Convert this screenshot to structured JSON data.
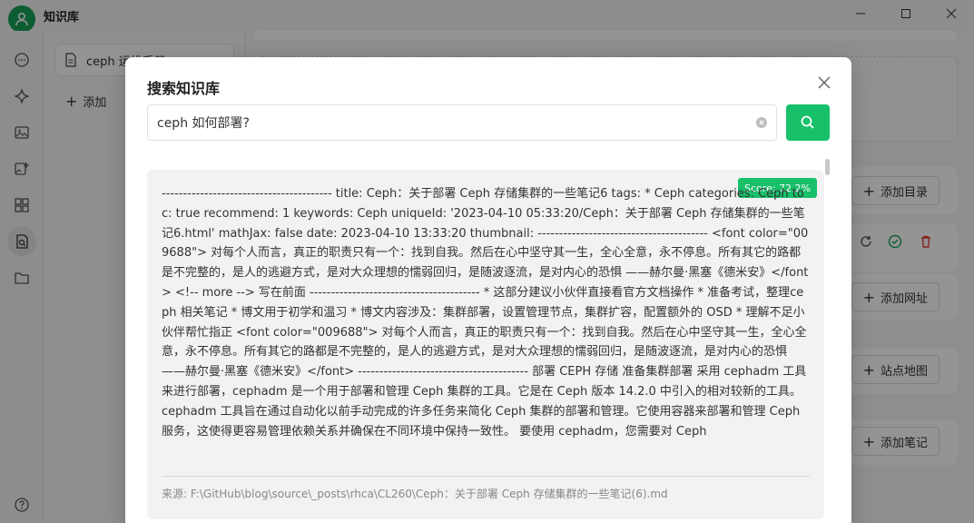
{
  "app": {
    "title": "知识库",
    "window_controls": {
      "minimize": "—",
      "maximize": "☐",
      "close": "✕"
    }
  },
  "rail": {
    "icons": [
      "chat-icon",
      "sparkle-icon",
      "image-icon",
      "image-edit-icon",
      "grid-icon",
      "knowledge-search-icon",
      "folder-icon",
      "help-icon"
    ],
    "active": "knowledge-search-icon"
  },
  "sidebar": {
    "kb_item_label": "ceph 运维手册",
    "add_label": "添加"
  },
  "main": {
    "buttons": {
      "add_directory": "添加目录",
      "add_url": "添加网址",
      "sitemap": "站点地图",
      "add_note": "添加笔记"
    },
    "status_icons": [
      "refresh-icon",
      "check-icon",
      "delete-icon"
    ]
  },
  "modal": {
    "title": "搜索知识库",
    "search_value": "ceph 如何部署?",
    "result": {
      "score": "Score: 72.2%",
      "text": "---------------------------------------- title: Ceph：关于部署 Ceph 存储集群的一些笔记6 tags: * Ceph categories: Ceph toc: true recommend: 1 keywords: Ceph uniqueId: '2023-04-10 05:33:20/Ceph：关于部署 Ceph 存储集群的一些笔记6.html' mathJax: false date: 2023-04-10 13:33:20 thumbnail: ---------------------------------------- <font color=\"009688\"> 对每个人而言，真正的职责只有一个：找到自我。然后在心中坚守其一生，全心全意，永不停息。所有其它的路都是不完整的，是人的逃避方式，是对大众理想的懦弱回归，是随波逐流，是对内心的恐惧 ——赫尔曼·黑塞《德米安》</font> <!-- more --> 写在前面 ---------------------------------------- * 这部分建议小伙伴直接看官方文档操作 * 准备考试，整理ceph 相关笔记 * 博文用于初学和温习 * 博文内容涉及：集群部署，设置管理节点，集群扩容，配置额外的 OSD * 理解不足小伙伴帮忙指正 <font color=\"009688\"> 对每个人而言，真正的职责只有一个：找到自我。然后在心中坚守其一生，全心全意，永不停息。所有其它的路都是不完整的，是人的逃避方式，是对大众理想的懦弱回归，是随波逐流，是对内心的恐惧 ——赫尔曼·黑塞《德米安》</font> ---------------------------------------- 部署 CEPH 存储 准备集群部署 采用 cephadm 工具来进行部署，cephadm 是一个用于部署和管理 Ceph 集群的工具。它是在 Ceph 版本 14.2.0 中引入的相对较新的工具。 cephadm 工具旨在通过自动化以前手动完成的许多任务来简化 Ceph 集群的部署和管理。它使用容器来部署和管理 Ceph 服务，这使得更容易管理依赖关系并确保在不同环境中保持一致性。 要使用 cephadm，您需要对 Ceph",
      "source": "来源: F:\\GitHub\\blog\\source\\_posts\\rhca\\CL260\\Ceph：关于部署 Ceph 存储集群的一些笔记(6).md"
    }
  },
  "colors": {
    "accent": "#18c06a",
    "logo": "#18a058",
    "delete": "#e53935"
  }
}
